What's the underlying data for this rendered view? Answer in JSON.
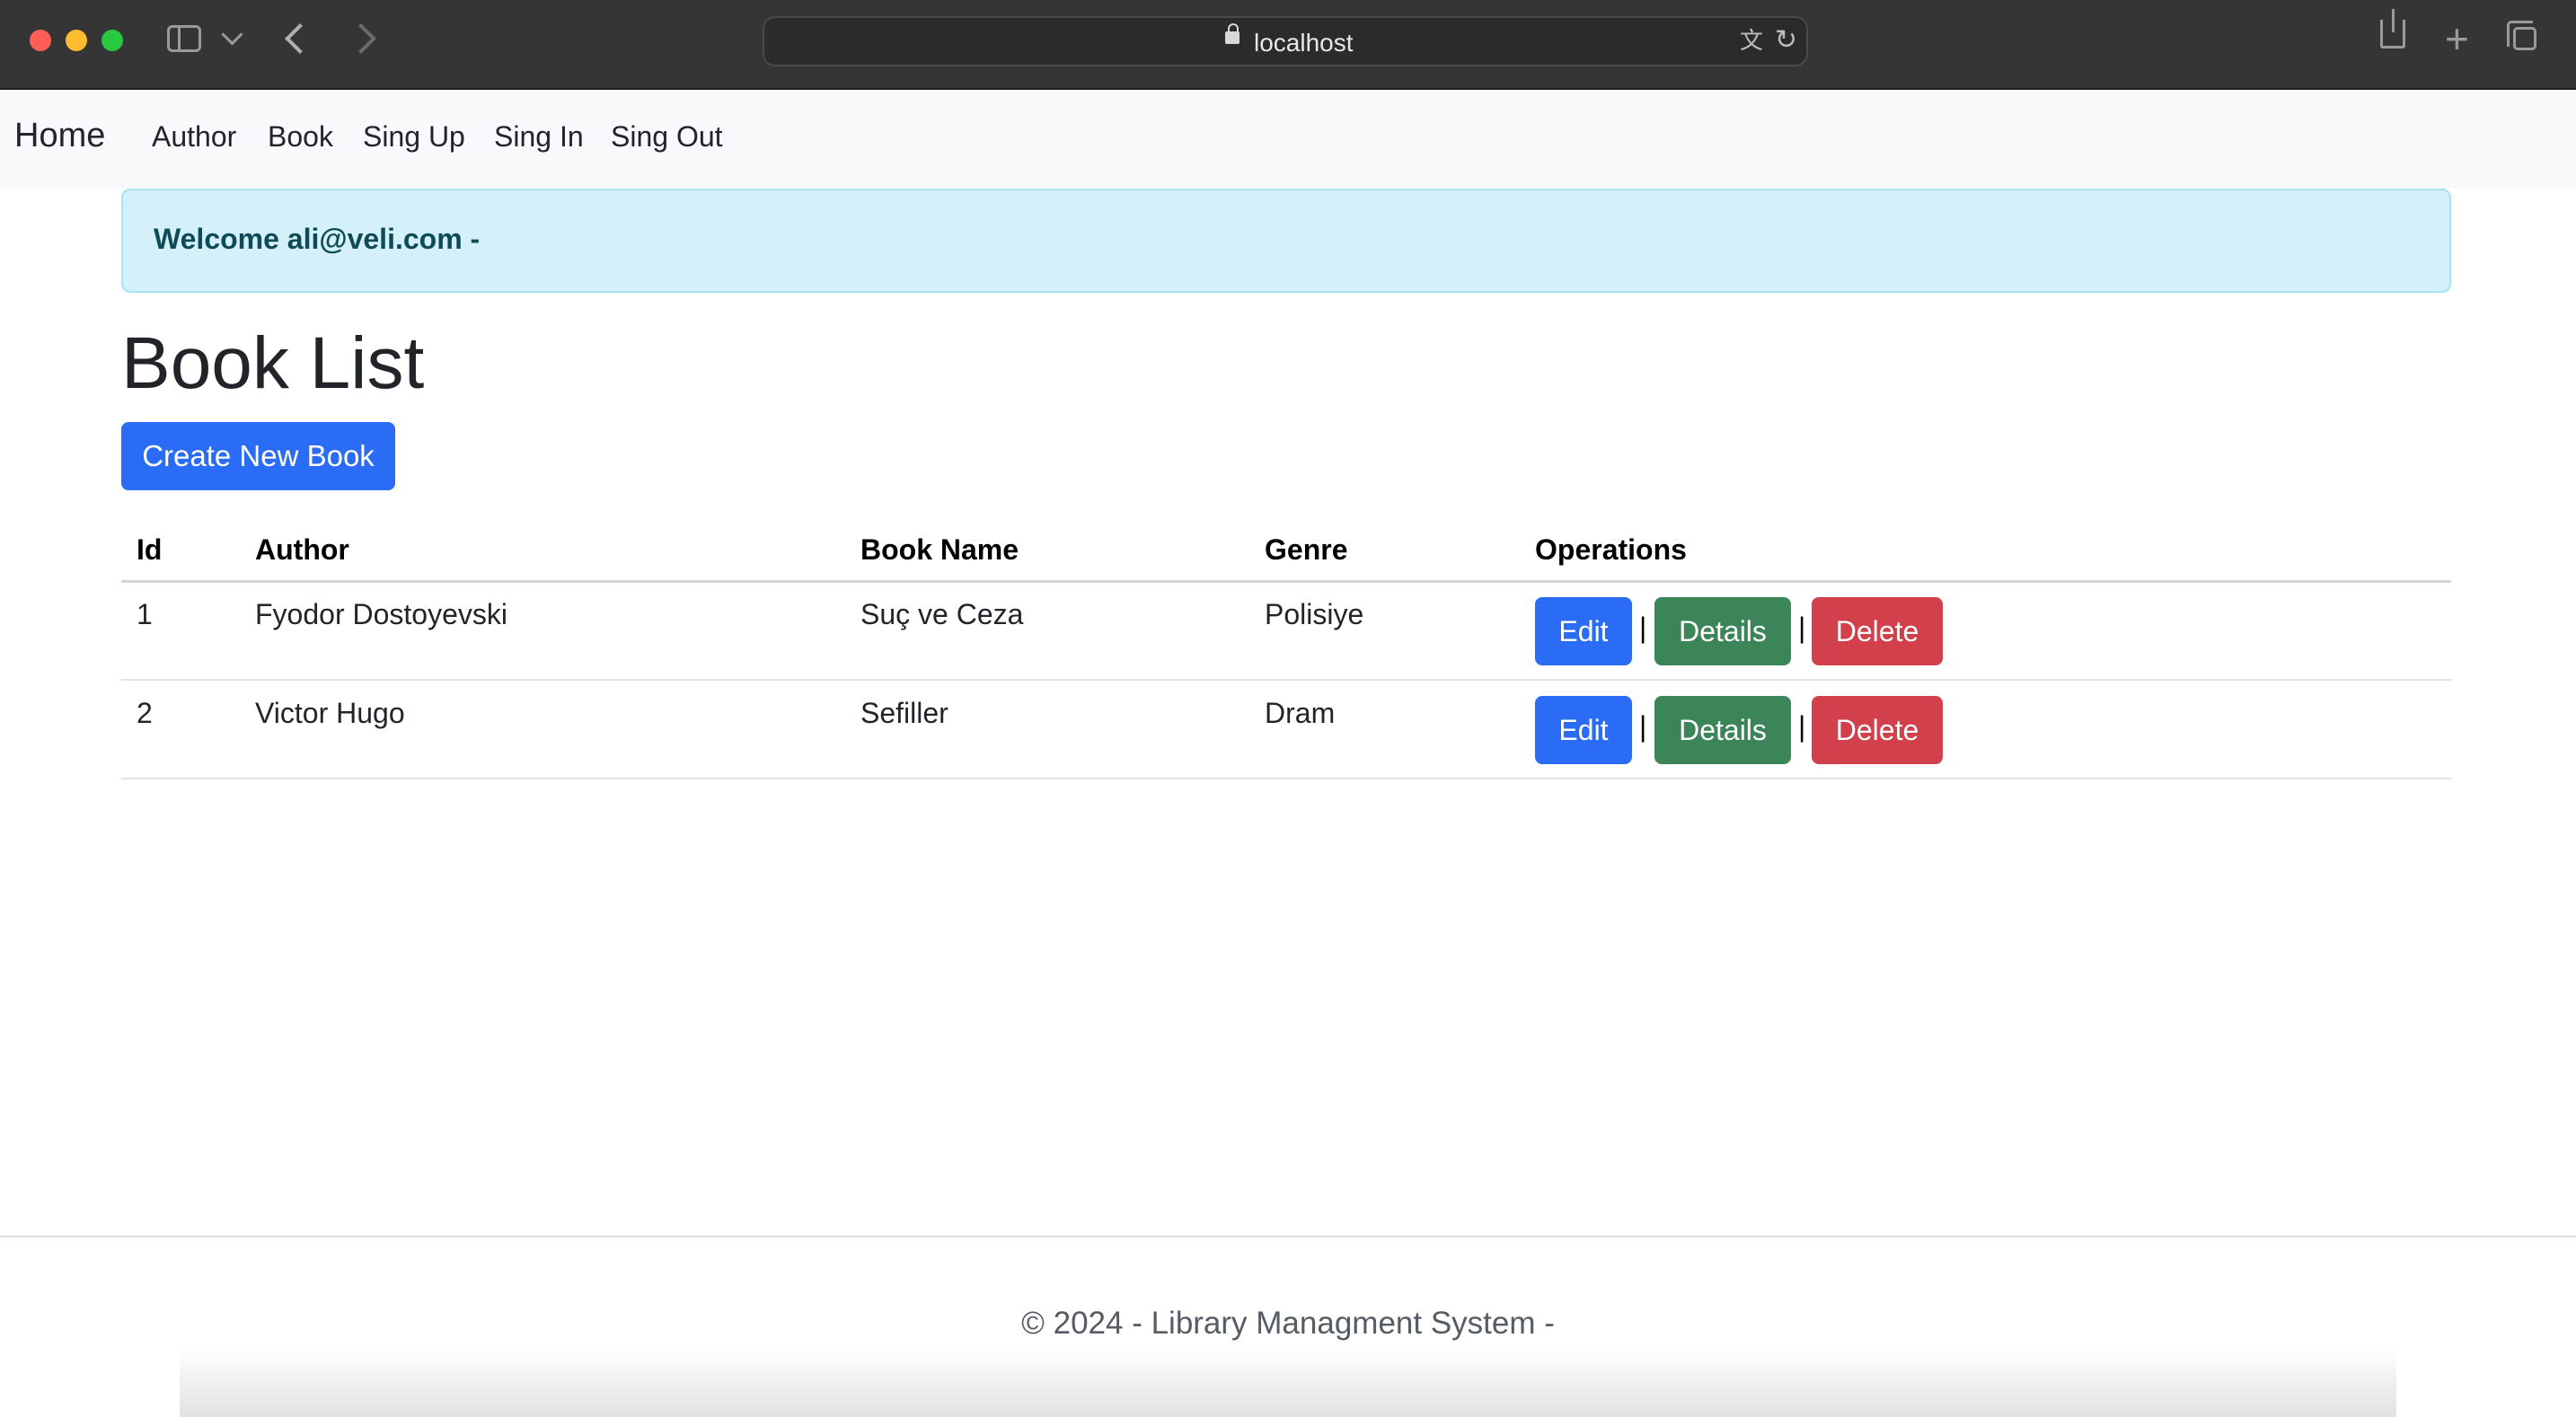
{
  "browser": {
    "url": "localhost"
  },
  "navbar": {
    "brand": "Home",
    "links": [
      "Author",
      "Book",
      "Sing Up",
      "Sing In",
      "Sing Out"
    ]
  },
  "alert": {
    "text": "Welcome ali@veli.com -"
  },
  "page": {
    "title": "Book List",
    "create_button": "Create New Book"
  },
  "table": {
    "headers": [
      "Id",
      "Author",
      "Book Name",
      "Genre",
      "Operations"
    ],
    "rows": [
      {
        "id": "1",
        "author": "Fyodor Dostoyevski",
        "book_name": "Suç ve Ceza",
        "genre": "Polisiye"
      },
      {
        "id": "2",
        "author": "Victor Hugo",
        "book_name": "Sefiller",
        "genre": "Dram"
      }
    ],
    "operations": {
      "edit": "Edit",
      "details": "Details",
      "delete": "Delete",
      "separator": "|"
    }
  },
  "footer": {
    "text": "© 2024 - Library Managment System -"
  },
  "colors": {
    "primary": "#2a6cf6",
    "success": "#3b8558",
    "danger": "#d1404b",
    "alert_bg": "#d4f1f9",
    "alert_text": "#0f4a57"
  }
}
